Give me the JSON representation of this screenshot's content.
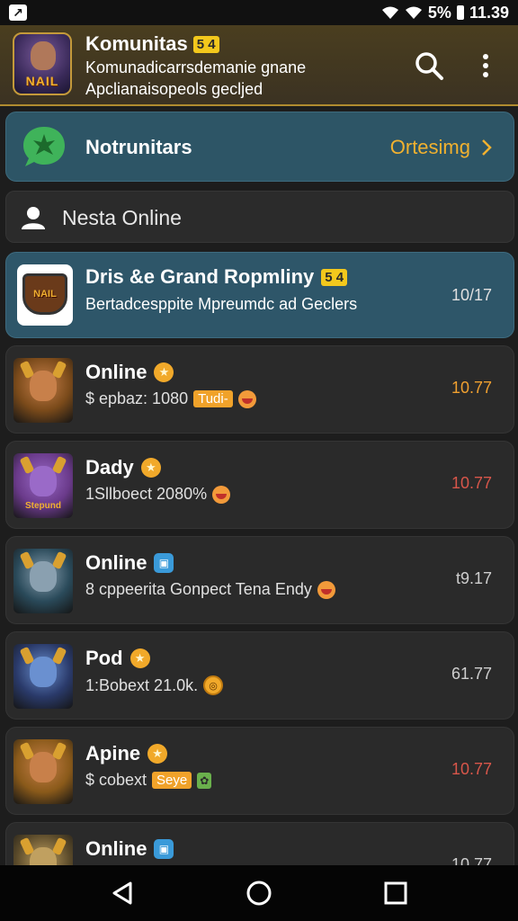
{
  "status_bar": {
    "battery": "5%",
    "time": "11.39"
  },
  "header": {
    "title": "Komunitas",
    "badge": "5 4",
    "subtitle1": "Komunadicarrsdemanie gnane",
    "subtitle2": "Apclianaisopeols gecljed",
    "logo_text": "NAIL"
  },
  "banner": {
    "title": "Notrunitars",
    "action": "Ortesimg"
  },
  "section": {
    "title": "Nesta Online"
  },
  "featured": {
    "title": "Dris &e Grand Ropmliny",
    "badge": "5 4",
    "subtitle": "Bertadcesppite Mpreumdc ad Geclers",
    "count": "10/17",
    "thumb_text": "NAIL"
  },
  "items": [
    {
      "title": "Online",
      "badge_type": "star",
      "sub": "$ epbaz: 1080",
      "tag": "Tudi-",
      "tag_type": "orange",
      "extra": "emoji",
      "count": "10.77",
      "count_color": "#f0a030",
      "thumb_bg": "#7a4a1a",
      "face": "#c8804a"
    },
    {
      "title": "Dady",
      "badge_type": "star",
      "sub": "1Sllboect 2080%",
      "tag": "",
      "tag_type": "",
      "extra": "emoji",
      "count": "10.77",
      "count_color": "#d8564a",
      "thumb_bg": "#6a3a8a",
      "face": "#9a6ac8",
      "thumb_text": "Stepund"
    },
    {
      "title": "Online",
      "badge_type": "square",
      "sub": "8 cppeerita Gonpect Tena Endy",
      "tag": "",
      "tag_type": "",
      "extra": "emoji",
      "count": "t9.17",
      "count_color": "#cfcfcf",
      "thumb_bg": "#2a4a5a",
      "face": "#8aa0b0"
    },
    {
      "title": "Pod",
      "badge_type": "star",
      "sub": "1:Bobext 21.0k.",
      "tag": "",
      "tag_type": "",
      "extra": "coin",
      "count": "61.77",
      "count_color": "#cfcfcf",
      "thumb_bg": "#2a3a6a",
      "face": "#6a90d0"
    },
    {
      "title": "Apine",
      "badge_type": "star",
      "sub": "$ cobext",
      "tag": "Seye",
      "tag_type": "orange",
      "extra": "green",
      "count": "10.77",
      "count_color": "#d8564a",
      "thumb_bg": "#8a5a1a",
      "face": "#c8804a"
    },
    {
      "title": "Online",
      "badge_type": "square",
      "sub": "",
      "tag": "",
      "tag_type": "",
      "extra": "",
      "count": "10.77",
      "count_color": "#cfcfcf",
      "thumb_bg": "#5a4a2a",
      "face": "#c0a060"
    }
  ]
}
